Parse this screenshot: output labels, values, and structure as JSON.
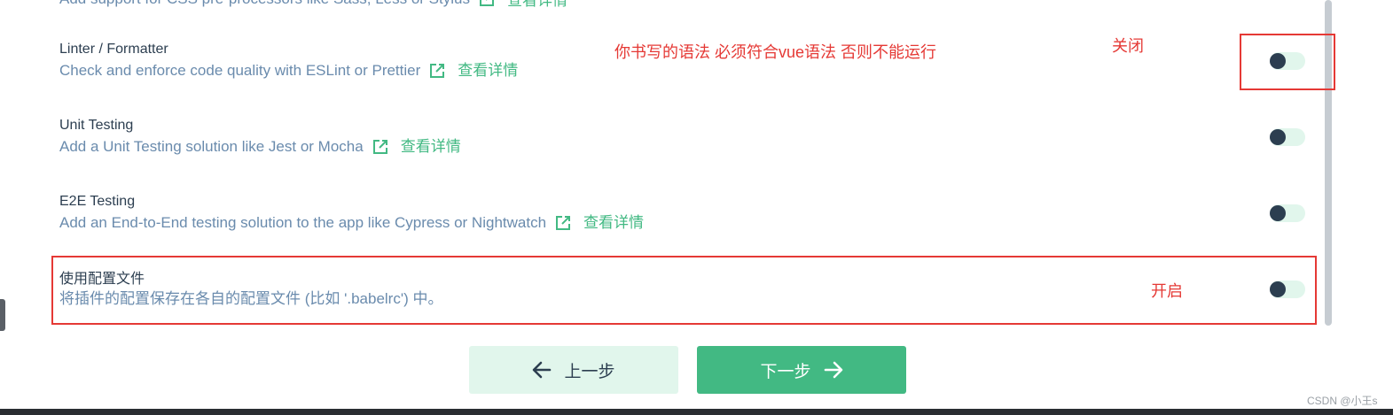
{
  "partial_top": {
    "desc": "Add support for CSS pre-processors like Sass, Less or Stylus",
    "more": "查看详情"
  },
  "features": [
    {
      "title": "Linter / Formatter",
      "desc": "Check and enforce code quality with ESLint or Prettier",
      "more": "查看详情",
      "enabled": false
    },
    {
      "title": "Unit Testing",
      "desc": "Add a Unit Testing solution like Jest or Mocha",
      "more": "查看详情",
      "enabled": false
    },
    {
      "title": "E2E Testing",
      "desc": "Add an End-to-End testing solution to the app like Cypress or Nightwatch",
      "more": "查看详情",
      "enabled": false
    },
    {
      "title": "使用配置文件",
      "desc": "将插件的配置保存在各自的配置文件 (比如 '.babelrc') 中。",
      "enabled": false
    }
  ],
  "annotations": {
    "linter_note": "你书写的语法 必须符合vue语法 否则不能运行",
    "off_label": "关闭",
    "on_label": "开启",
    "color": "#e53935"
  },
  "nav": {
    "prev_label": "上一步",
    "next_label": "下一步"
  },
  "watermark": "CSDN @小王s",
  "colors": {
    "accent": "#42b983",
    "accent_light": "#e1f6ec",
    "title": "#2c3e50",
    "desc": "#6a8bad"
  }
}
